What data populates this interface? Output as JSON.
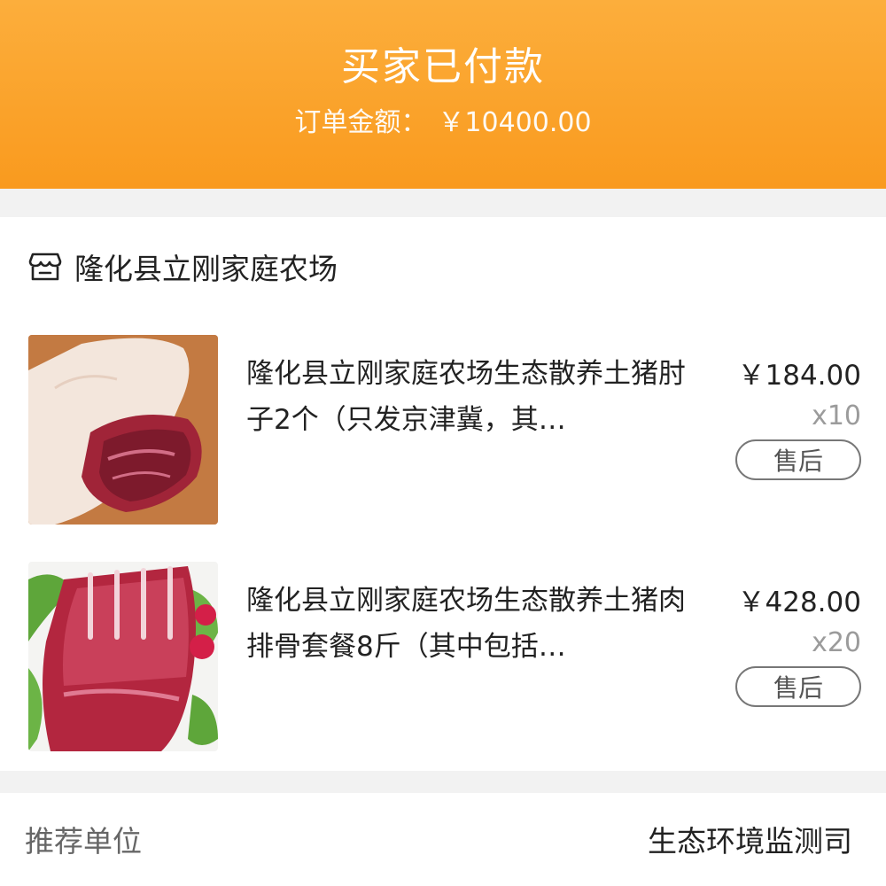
{
  "header": {
    "status": "买家已付款",
    "amount_label": "订单金额：",
    "amount_value": "￥10400.00"
  },
  "shop": {
    "icon": "store-icon",
    "name": "隆化县立刚家庭农场"
  },
  "items": [
    {
      "image": "pork-hock-photo",
      "title": "隆化县立刚家庭农场生态散养土猪肘子2个（只发京津冀，其…",
      "price": "￥184.00",
      "qty": "x10",
      "after_sale": "售后"
    },
    {
      "image": "pork-ribs-photo",
      "title": "隆化县立刚家庭农场生态散养土猪肉排骨套餐8斤（其中包括…",
      "price": "￥428.00",
      "qty": "x20",
      "after_sale": "售后"
    }
  ],
  "recommend": {
    "label": "推荐单位",
    "value": "生态环境监测司"
  },
  "colors": {
    "header_orange": "#f99a1e",
    "page_bg": "#f2f2f2"
  }
}
